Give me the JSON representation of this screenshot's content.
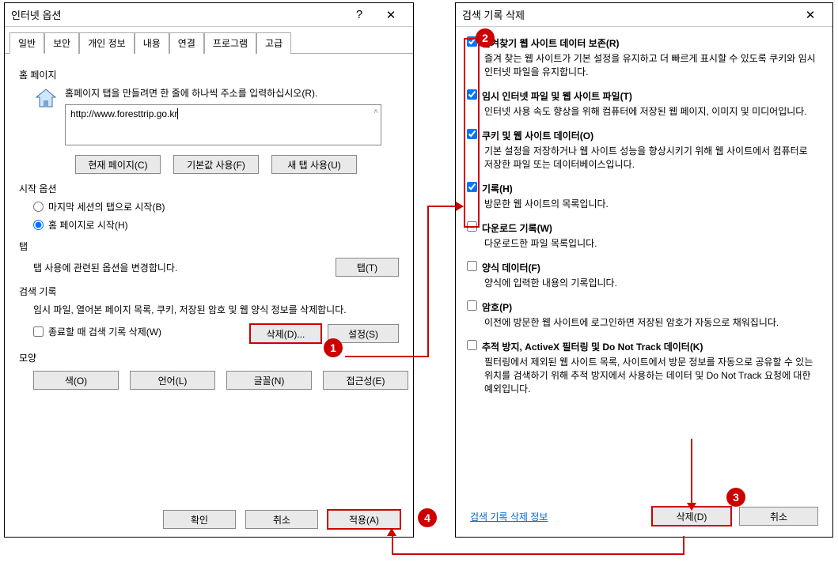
{
  "left": {
    "title": "인터넷 옵션",
    "help": "?",
    "close": "✕",
    "tabs": [
      "일반",
      "보안",
      "개인 정보",
      "내용",
      "연결",
      "프로그램",
      "고급"
    ],
    "homepage": {
      "section": "홈 페이지",
      "instruction": "홈페이지 탭을 만들려면 한 줄에 하나씩 주소를 입력하십시오(R).",
      "url": "http://www.foresttrip.go.kr",
      "btn_current": "현재 페이지(C)",
      "btn_default": "기본값 사용(F)",
      "btn_newtab": "새 탭 사용(U)"
    },
    "startup": {
      "section": "시작 옵션",
      "radio_last": "마지막 세션의 탭으로 시작(B)",
      "radio_home": "홈 페이지로 시작(H)"
    },
    "tabsec": {
      "section": "탭",
      "text": "탭 사용에 관련된 옵션을 변경합니다.",
      "btn": "탭(T)"
    },
    "history": {
      "section": "검색 기록",
      "text": "임시 파일, 열어본 페이지 목록, 쿠키, 저장된 암호 및 웹 양식 정보를 삭제합니다.",
      "check": "종료할 때 검색 기록 삭제(W)",
      "btn_delete": "삭제(D)...",
      "btn_settings": "설정(S)"
    },
    "appearance": {
      "section": "모양",
      "btn_color": "색(O)",
      "btn_lang": "언어(L)",
      "btn_font": "글꼴(N)",
      "btn_access": "접근성(E)"
    },
    "bottom": {
      "ok": "확인",
      "cancel": "취소",
      "apply": "적용(A)"
    }
  },
  "right": {
    "title": "검색 기록 삭제",
    "close": "✕",
    "items": [
      {
        "checked": true,
        "label": "즐겨찾기 웹 사이트 데이터 보존(R)",
        "desc": "즐겨 찾는 웹 사이트가 기본 설정을 유지하고 더 빠르게 표시할 수 있도록 쿠키와 임시 인터넷 파일을 유지합니다."
      },
      {
        "checked": true,
        "label": "임시 인터넷 파일 및 웹 사이트 파일(T)",
        "desc": "인터넷 사용 속도 향상을 위해 컴퓨터에 저장된 웹 페이지, 이미지 및 미디어입니다."
      },
      {
        "checked": true,
        "label": "쿠키 및 웹 사이트 데이터(O)",
        "desc": "기본 설정을 저장하거나 웹 사이트 성능을 향상시키기 위해 웹 사이트에서 컴퓨터로 저장한 파일 또는 데이터베이스입니다."
      },
      {
        "checked": true,
        "label": "기록(H)",
        "desc": "방문한 웹 사이트의 목록입니다."
      },
      {
        "checked": false,
        "label": "다운로드 기록(W)",
        "desc": "다운로드한 파일 목록입니다."
      },
      {
        "checked": false,
        "label": "양식 데이터(F)",
        "desc": "양식에 입력한 내용의 기록입니다."
      },
      {
        "checked": false,
        "label": "암호(P)",
        "desc": "이전에 방문한 웹 사이트에 로그인하면 저장된 암호가 자동으로 채워집니다."
      },
      {
        "checked": false,
        "label": "추적 방지, ActiveX 필터링 및 Do Not Track 데이터(K)",
        "desc": "필터링에서 제외된 웹 사이트 목록, 사이트에서 방문 정보를 자동으로 공유할 수 있는 위치를 검색하기 위해 추적 방지에서 사용하는 데이터 및 Do Not Track 요청에 대한 예외입니다."
      }
    ],
    "link": "검색 기록 삭제 정보",
    "btn_delete": "삭제(D)",
    "btn_cancel": "취소"
  },
  "callouts": {
    "c1": "1",
    "c2": "2",
    "c3": "3",
    "c4": "4"
  }
}
